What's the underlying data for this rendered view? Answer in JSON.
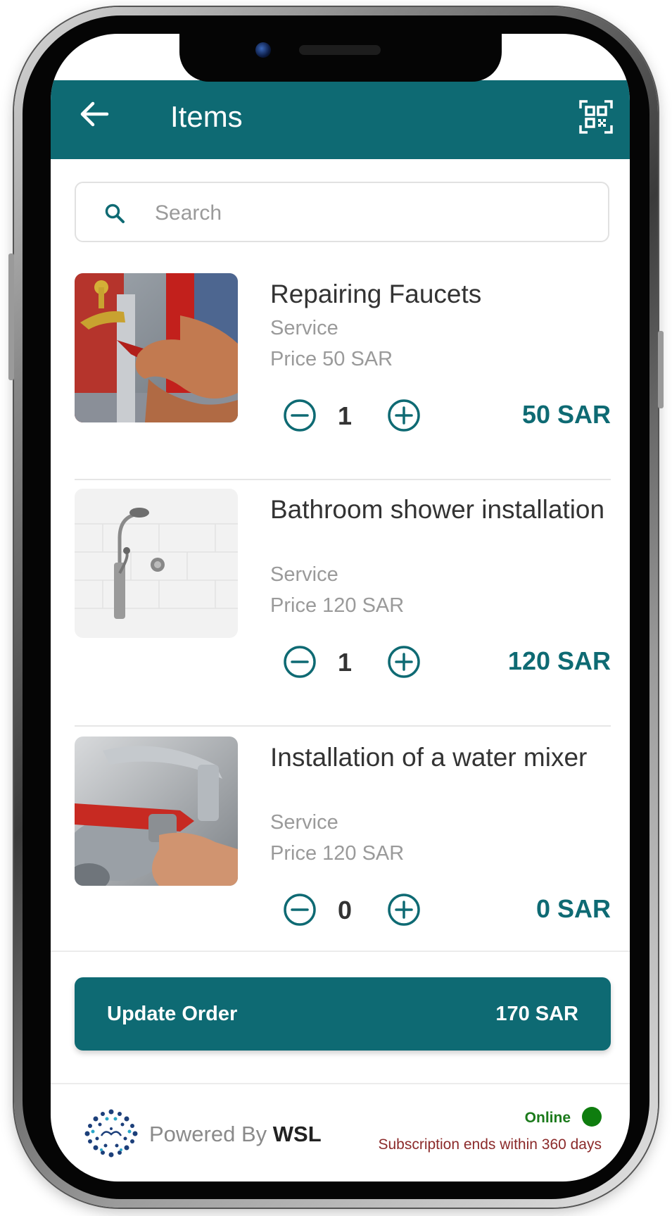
{
  "header": {
    "title": "Items",
    "back_icon": "arrow-left-icon",
    "scan_icon": "qr-code-icon"
  },
  "search": {
    "placeholder": "Search",
    "value": "",
    "icon": "search-icon"
  },
  "items": [
    {
      "name": "Repairing Faucets",
      "type": "Service",
      "price_label": "Price 50 SAR",
      "quantity": "1",
      "total": "50 SAR"
    },
    {
      "name": "Bathroom shower installation",
      "type": "Service",
      "price_label": "Price 120 SAR",
      "quantity": "1",
      "total": "120 SAR"
    },
    {
      "name": "Installation of a water mixer",
      "type": "Service",
      "price_label": "Price 120 SAR",
      "quantity": "0",
      "total": "0 SAR"
    }
  ],
  "order": {
    "button_label": "Update Order",
    "total": "170 SAR"
  },
  "footer": {
    "powered_by_prefix": "Powered By ",
    "brand": "WSL",
    "status": "Online",
    "subscription": "Subscription ends within 360 days"
  },
  "colors": {
    "primary": "#0e6a73",
    "online": "#0f7d0f",
    "subscription_text": "#8b2a2a"
  }
}
